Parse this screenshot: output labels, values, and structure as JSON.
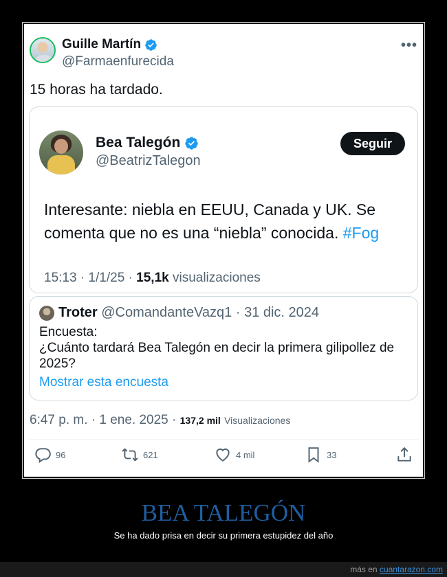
{
  "main_tweet": {
    "name": "Guille Martín",
    "handle": "@Farmaenfurecida",
    "text": "15 horas ha tardado.",
    "more": "•••",
    "time": "6:47 p. m. · 1 ene. 2025 ·",
    "views": "137,2 mil",
    "views_label": "Visualizaciones"
  },
  "quoted_tweet": {
    "name": "Bea Talegón",
    "handle": "@BeatrizTalegon",
    "follow_label": "Seguir",
    "text": "Interesante: niebla en EEUU, Canada y UK. Se comenta que no es una “niebla” conocida. ",
    "hashtag": "#Fog",
    "time": "15:13 · 1/1/25 · ",
    "views": "15,1k",
    "views_label": " visualizaciones"
  },
  "poll_tweet": {
    "name": "Troter",
    "handle_date": " @ComandanteVazq1 · 31 dic. 2024",
    "line1": "Encuesta:",
    "line2": "¿Cuánto tardará Bea Talegón en decir la primera gilipollez de 2025?",
    "link": "Mostrar esta encuesta"
  },
  "actions": {
    "replies": "96",
    "retweets": "621",
    "likes": "4 mil",
    "bookmarks": "33"
  },
  "caption": {
    "title": "BEA TALEGÓN",
    "subtitle": "Se ha dado prisa en decir su primera estupidez del año"
  },
  "footer": {
    "prefix": "más en ",
    "site": "cuantarazon.com"
  },
  "colors": {
    "accent": "#1d9bf0",
    "title": "#1e5ea0",
    "verified": "#1d9bf0"
  }
}
